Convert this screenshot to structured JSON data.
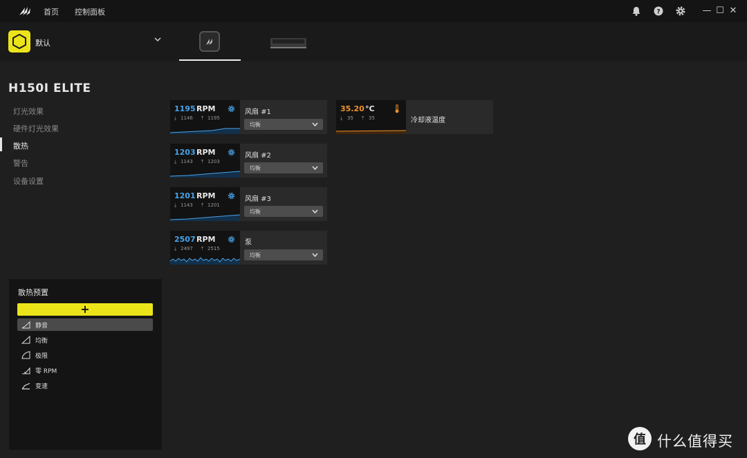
{
  "titlebar": {
    "nav": {
      "home": "首页",
      "control_panel": "控制面板"
    },
    "icons": [
      "bell-icon",
      "help-icon",
      "gear-icon",
      "minimize-icon",
      "maximize-icon",
      "close-icon"
    ],
    "window_glyphs": {
      "minimize": "—",
      "maximize": "☐",
      "close": "✕"
    }
  },
  "profile": {
    "name": "默认"
  },
  "device": {
    "title": "H150I ELITE"
  },
  "sidebar": {
    "items": [
      {
        "label": "灯光效果"
      },
      {
        "label": "硬件灯光效果"
      },
      {
        "label": "散热",
        "active": true
      },
      {
        "label": "警告"
      },
      {
        "label": "设备设置"
      }
    ]
  },
  "presets": {
    "title": "散热预置",
    "add_label": "+",
    "items": [
      {
        "label": "静音",
        "selected": true
      },
      {
        "label": "均衡"
      },
      {
        "label": "极限"
      },
      {
        "label": "零 RPM"
      },
      {
        "label": "变速"
      }
    ]
  },
  "fans": [
    {
      "rpm": "1195",
      "unit": "RPM",
      "min": "1146",
      "max": "1195",
      "name": "风扇 #1",
      "mode": "均衡"
    },
    {
      "rpm": "1203",
      "unit": "RPM",
      "min": "1143",
      "max": "1203",
      "name": "风扇 #2",
      "mode": "均衡"
    },
    {
      "rpm": "1201",
      "unit": "RPM",
      "min": "1143",
      "max": "1201",
      "name": "风扇 #3",
      "mode": "均衡"
    },
    {
      "rpm": "2507",
      "unit": "RPM",
      "min": "2497",
      "max": "2515",
      "name": "泵",
      "mode": "均衡"
    }
  ],
  "temperature": {
    "value": "35.20",
    "unit": "°C",
    "min": "35",
    "max": "35",
    "name": "冷却液温度"
  },
  "watermark": {
    "text": "什么值得买",
    "glyph": "值"
  },
  "colors": {
    "accent": "#ece41a",
    "rpm": "#4aa3e8",
    "temp": "#f0922a"
  }
}
